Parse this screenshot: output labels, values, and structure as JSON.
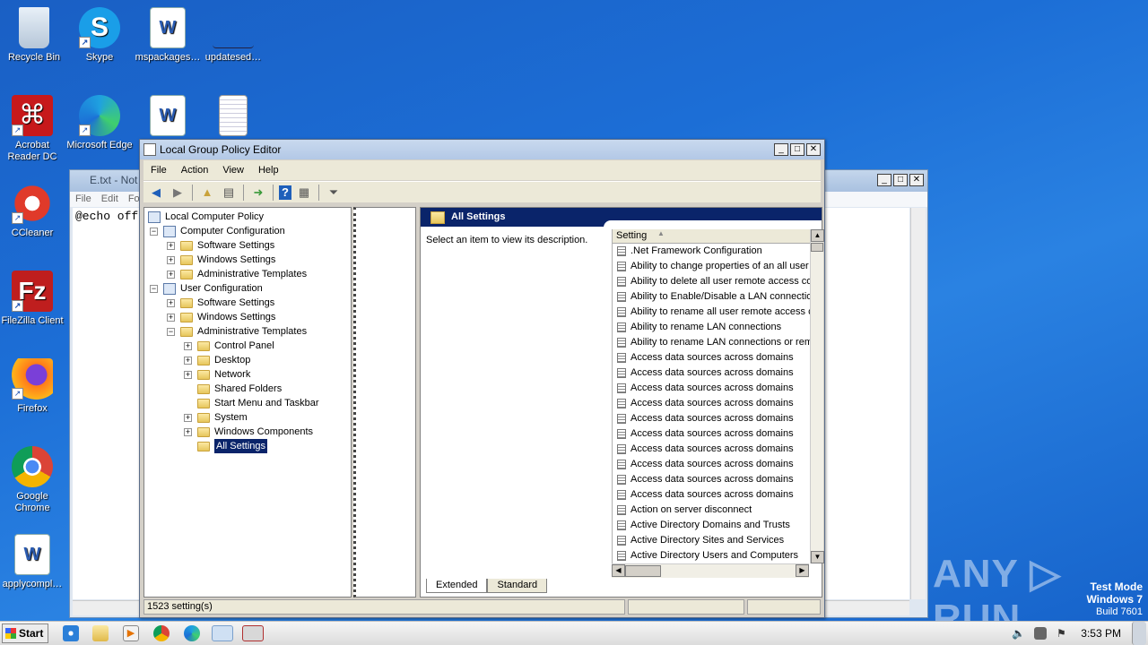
{
  "desktop": {
    "icons": [
      {
        "label": "Recycle Bin"
      },
      {
        "label": "Skype"
      },
      {
        "label": "mspackages…"
      },
      {
        "label": "updatesed…"
      },
      {
        "label": "Acrobat Reader DC"
      },
      {
        "label": "Microsoft Edge"
      },
      {
        "label": "CCleaner"
      },
      {
        "label": "FileZilla Client"
      },
      {
        "label": "Firefox"
      },
      {
        "label": "Google Chrome"
      },
      {
        "label": "applycompl…"
      }
    ]
  },
  "notepad": {
    "title": "E.txt - Not",
    "menu": [
      "File",
      "Edit",
      "Fo"
    ],
    "content": "@echo off"
  },
  "gpedit": {
    "title": "Local Group Policy Editor",
    "menu": [
      "File",
      "Action",
      "View",
      "Help"
    ],
    "tree": {
      "root": "Local Computer Policy",
      "computer_config": "Computer Configuration",
      "cc_software": "Software Settings",
      "cc_windows": "Windows Settings",
      "cc_admin": "Administrative Templates",
      "user_config": "User Configuration",
      "uc_software": "Software Settings",
      "uc_windows": "Windows Settings",
      "uc_admin": "Administrative Templates",
      "control_panel": "Control Panel",
      "desktop": "Desktop",
      "network": "Network",
      "shared_folders": "Shared Folders",
      "start_menu": "Start Menu and Taskbar",
      "system": "System",
      "windows_components": "Windows Components",
      "all_settings": "All Settings"
    },
    "right": {
      "header": "All Settings",
      "description": "Select an item to view its description.",
      "column": "Setting",
      "rows": [
        ".Net Framework Configuration",
        "Ability to change properties of an all user",
        "Ability to delete all user remote access co",
        "Ability to Enable/Disable a LAN connectior",
        "Ability to rename all user remote access c",
        "Ability to rename LAN connections",
        "Ability to rename LAN connections or rem",
        "Access data sources across domains",
        "Access data sources across domains",
        "Access data sources across domains",
        "Access data sources across domains",
        "Access data sources across domains",
        "Access data sources across domains",
        "Access data sources across domains",
        "Access data sources across domains",
        "Access data sources across domains",
        "Access data sources across domains",
        "Action on server disconnect",
        "Active Directory Domains and Trusts",
        "Active Directory Sites and Services",
        "Active Directory Users and Computers"
      ],
      "tabs": [
        "Extended",
        "Standard"
      ]
    },
    "status": "1523 setting(s)"
  },
  "taskbar": {
    "start": "Start",
    "clock": "3:53 PM"
  },
  "watermark": "ANY ▷ RUN",
  "test_mode": {
    "line1": "Test Mode",
    "line2": "Windows 7",
    "line3": "Build 7601"
  }
}
